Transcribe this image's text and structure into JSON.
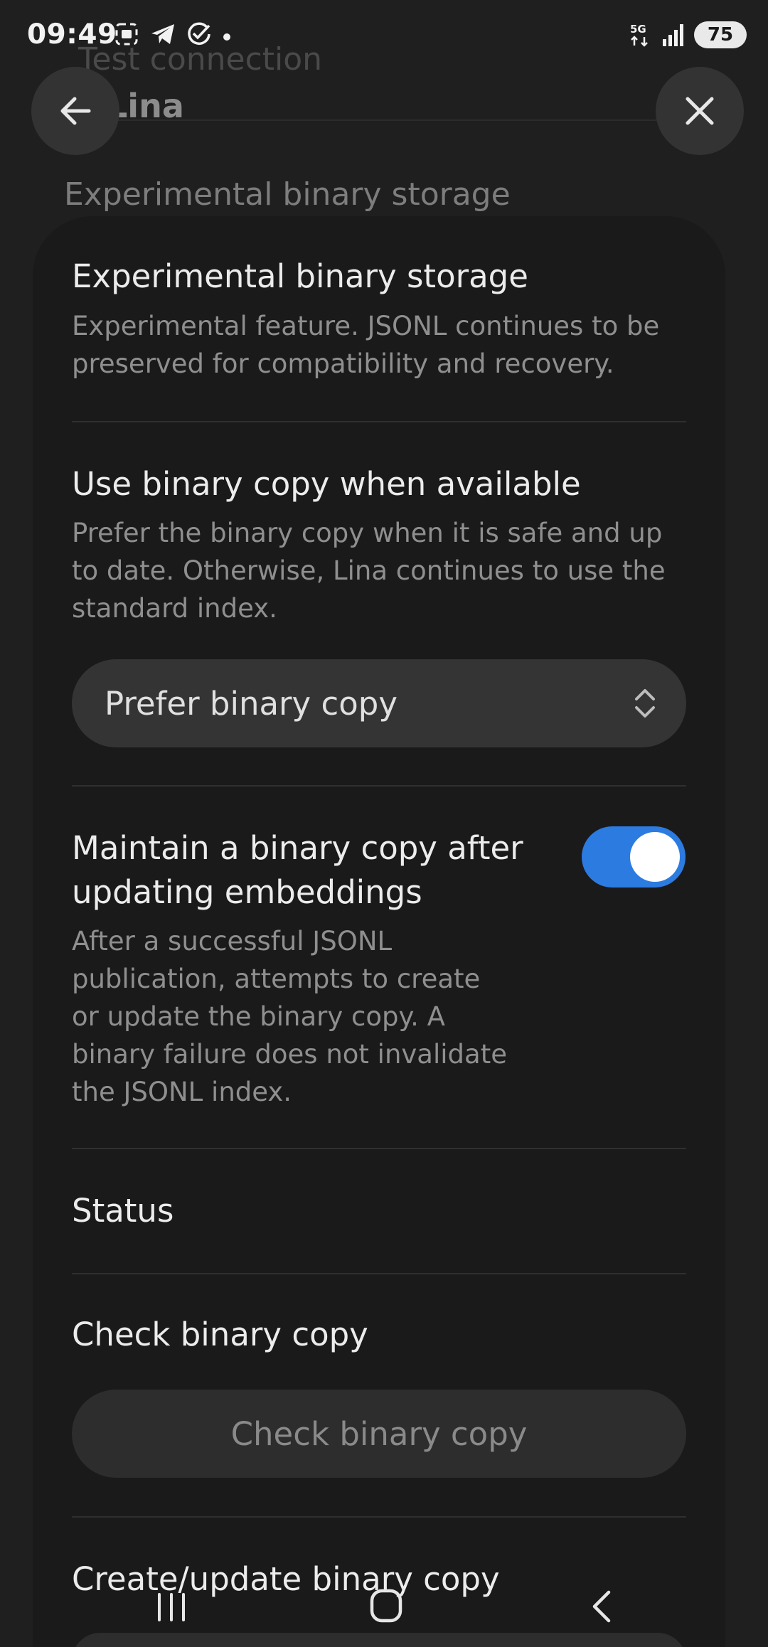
{
  "status_bar": {
    "time": "09:49",
    "network": "5G",
    "battery": "75"
  },
  "background": {
    "faded_title": "Test connection",
    "header_title": "Lina",
    "section_title": "Experimental binary storage"
  },
  "sheet": {
    "title": "Experimental binary storage",
    "description": "Experimental feature. JSONL continues to be preserved for compatibility and recovery.",
    "use_binary": {
      "title": "Use binary copy when available",
      "description": "Prefer the binary copy when it is safe and up to date. Otherwise, Lina continues to use the standard index.",
      "select_value": "Prefer binary copy"
    },
    "maintain": {
      "title_line1": "Maintain a binary copy after",
      "title_line2": "updating embeddings",
      "description_lines": [
        "After a successful JSONL",
        "publication, attempts to create",
        "or update the binary copy. A",
        "binary failure does not invalidate",
        "the JSONL index."
      ],
      "enabled": true
    },
    "status": {
      "label": "Status"
    },
    "check": {
      "title": "Check binary copy",
      "button": "Check binary copy"
    },
    "create": {
      "title": "Create/update binary copy"
    }
  },
  "colors": {
    "accent": "#2c7be0",
    "sheet_bg": "#1a1a1b",
    "page_bg": "#1f1f20"
  },
  "icons": {
    "back": "arrow-left-icon",
    "close": "close-icon",
    "select": "chevron-up-down-icon",
    "nav_recents": "recents-icon",
    "nav_home": "home-icon",
    "nav_back": "back-chevron-icon"
  }
}
